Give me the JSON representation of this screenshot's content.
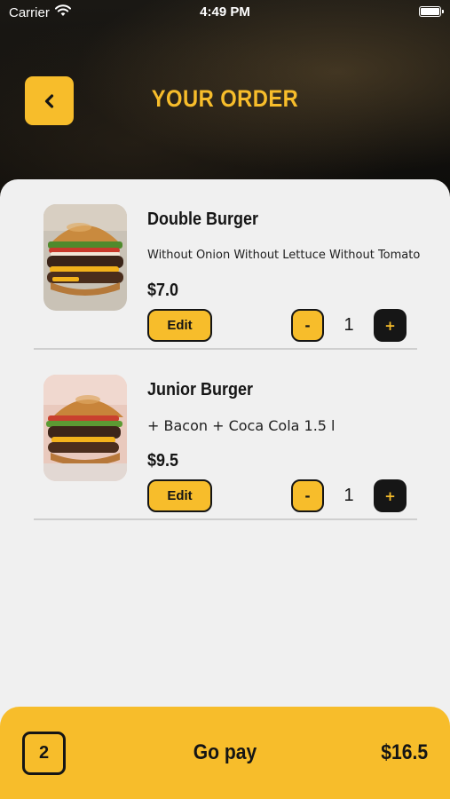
{
  "status_bar": {
    "carrier": "Carrier",
    "time": "4:49 PM",
    "wifi_icon": "wifi-icon",
    "battery_icon": "battery-icon"
  },
  "header": {
    "title": "YOUR ORDER",
    "back_icon": "chevron-left-icon"
  },
  "colors": {
    "accent": "#f7bd2b",
    "dark": "#151515",
    "background": "#f0f0f0",
    "divider": "#cfcfcf"
  },
  "items": [
    {
      "name": "Double Burger",
      "description": "Without Onion Without Lettuce Without Tomato",
      "price": "$7.0",
      "edit_label": "Edit",
      "minus_label": "-",
      "quantity": "1",
      "plus_label": "+",
      "image_icon": "burger-photo"
    },
    {
      "name": "Junior Burger",
      "description": "+ Bacon + Coca Cola 1.5 l",
      "price": "$9.5",
      "edit_label": "Edit",
      "minus_label": "-",
      "quantity": "1",
      "plus_label": "+",
      "image_icon": "burger-photo"
    }
  ],
  "footer": {
    "item_count": "2",
    "action_label": "Go pay",
    "total": "$16.5"
  }
}
